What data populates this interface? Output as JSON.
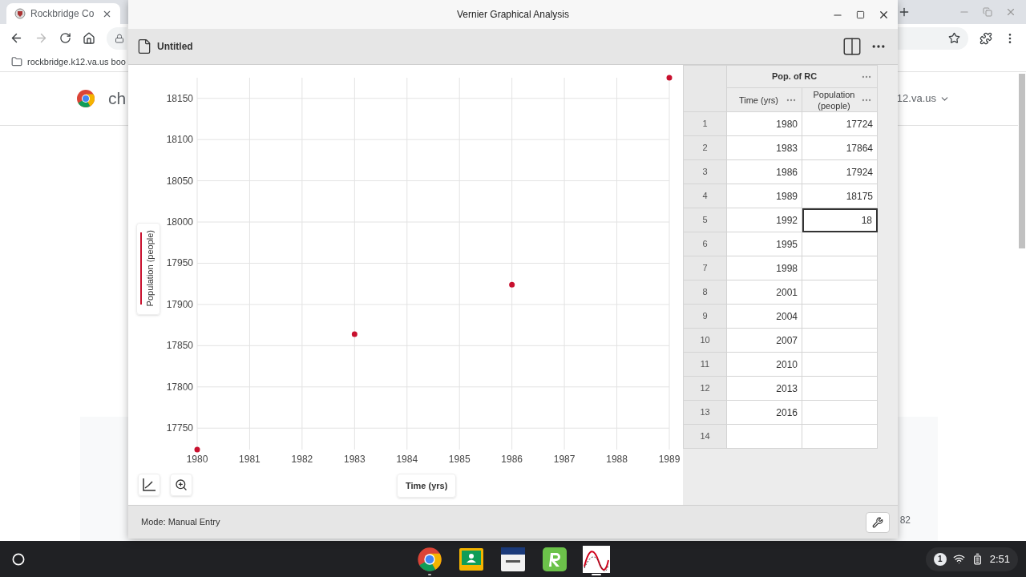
{
  "browser": {
    "tab_title": "Rockbridge Co",
    "bookmark": "rockbridge.k12.va.us boo",
    "page_heading": "ch",
    "account_domain": "12.va.us",
    "page_number": "82"
  },
  "app": {
    "title": "Vernier Graphical Analysis",
    "document_title": "Untitled",
    "chart_data": {
      "type": "scatter",
      "xlabel": "Time (yrs)",
      "ylabel": "Population (people)",
      "x": [
        1980,
        1983,
        1986,
        1989
      ],
      "series": [
        {
          "color": "#c8102e",
          "values": [
            17724,
            17864,
            17924,
            18175
          ]
        }
      ],
      "grid": true,
      "xlim": [
        1980,
        1989
      ],
      "ylim": [
        17724,
        18175
      ],
      "xticks": [
        1980,
        1981,
        1982,
        1983,
        1984,
        1985,
        1986,
        1987,
        1988,
        1989
      ],
      "yticks": [
        17750,
        17800,
        17850,
        17900,
        17950,
        18000,
        18050,
        18100,
        18150
      ]
    },
    "table": {
      "group_title": "Pop. of RC",
      "columns": [
        "Time (yrs)",
        "Population (people)"
      ],
      "rows": [
        {
          "index": "1",
          "time": "1980",
          "population": "17724",
          "editing": false
        },
        {
          "index": "2",
          "time": "1983",
          "population": "17864",
          "editing": false
        },
        {
          "index": "3",
          "time": "1986",
          "population": "17924",
          "editing": false
        },
        {
          "index": "4",
          "time": "1989",
          "population": "18175",
          "editing": false
        },
        {
          "index": "5",
          "time": "1992",
          "population": "18",
          "editing": true
        },
        {
          "index": "6",
          "time": "1995",
          "editing": false
        },
        {
          "index": "7",
          "time": "1998",
          "editing": false
        },
        {
          "index": "8",
          "time": "2001",
          "editing": false
        },
        {
          "index": "9",
          "time": "2004",
          "editing": false
        },
        {
          "index": "10",
          "time": "2007",
          "editing": false
        },
        {
          "index": "11",
          "time": "2010",
          "editing": false
        },
        {
          "index": "12",
          "time": "2013",
          "editing": false
        },
        {
          "index": "13",
          "time": "2016",
          "editing": false
        },
        {
          "index": "14",
          "editing": false
        }
      ]
    },
    "status": "Mode: Manual Entry"
  },
  "taskbar": {
    "apps": [
      {
        "kind": "chrome",
        "open": true,
        "active": false
      },
      {
        "kind": "classroom",
        "open": false,
        "active": false
      },
      {
        "kind": "testnav",
        "open": false,
        "active": false
      },
      {
        "kind": "r-app",
        "open": false,
        "active": false
      },
      {
        "kind": "vernier",
        "open": true,
        "active": true
      }
    ],
    "notification_count": "1",
    "time": "2:51"
  }
}
